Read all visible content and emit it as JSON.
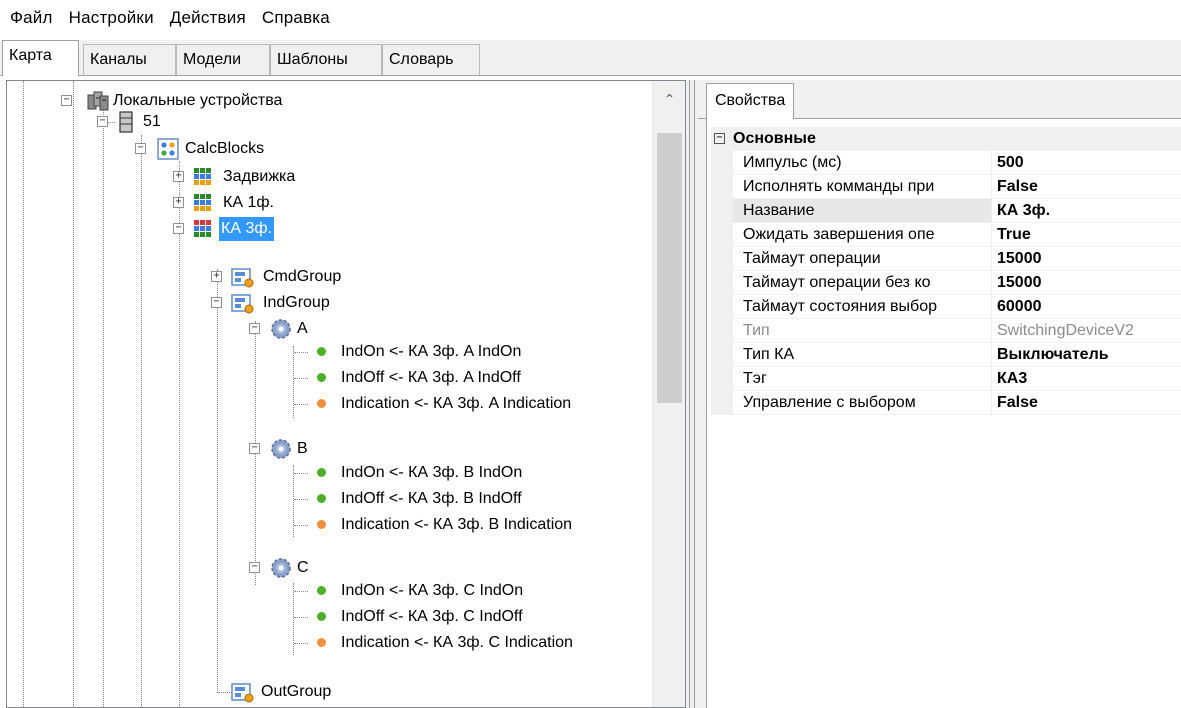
{
  "menu": [
    "Файл",
    "Настройки",
    "Действия",
    "Справка"
  ],
  "tabs": [
    "Карта",
    "Каналы",
    "Модели",
    "Шаблоны",
    "Словарь"
  ],
  "tree": {
    "root": "Локальные устройства",
    "device": "51",
    "calcblocks": "CalcBlocks",
    "items": [
      "Задвижка",
      "КА 1ф.",
      "КА 3ф."
    ],
    "cmdgroup": "CmdGroup",
    "indgroup": "IndGroup",
    "groups": [
      {
        "name": "A",
        "signals": [
          "IndOn <- КА 3ф. A IndOn",
          "IndOff <- КА 3ф. A IndOff",
          "Indication <- КА 3ф. A Indication"
        ]
      },
      {
        "name": "B",
        "signals": [
          "IndOn <- КА 3ф. B IndOn",
          "IndOff <- КА 3ф. B IndOff",
          "Indication <- КА 3ф. B Indication"
        ]
      },
      {
        "name": "C",
        "signals": [
          "IndOn <- КА 3ф. C IndOn",
          "IndOff <- КА 3ф. C IndOff",
          "Indication <- КА 3ф. C Indication"
        ]
      }
    ],
    "outgroup": "OutGroup"
  },
  "properties": {
    "tab": "Свойства",
    "category": "Основные",
    "rows": [
      {
        "name": "Импульс (мс)",
        "value": "500"
      },
      {
        "name": "Исполнять комманды при",
        "value": "False"
      },
      {
        "name": "Название",
        "value": "КА 3ф."
      },
      {
        "name": "Ожидать завершения опе",
        "value": "True"
      },
      {
        "name": "Таймаут операции",
        "value": "15000"
      },
      {
        "name": "Таймаут операции без ко",
        "value": "15000"
      },
      {
        "name": "Таймаут состояния выбор",
        "value": "60000"
      },
      {
        "name": "Тип",
        "value": "SwitchingDeviceV2"
      },
      {
        "name": "Тип КА",
        "value": "Выключатель"
      },
      {
        "name": "Тэг",
        "value": "КА3"
      },
      {
        "name": "Управление с выбором",
        "value": "False"
      }
    ]
  },
  "colors": {
    "selection": "#3399ff",
    "ok_dot": "#4caf2a",
    "warn_dot": "#f0903a"
  }
}
